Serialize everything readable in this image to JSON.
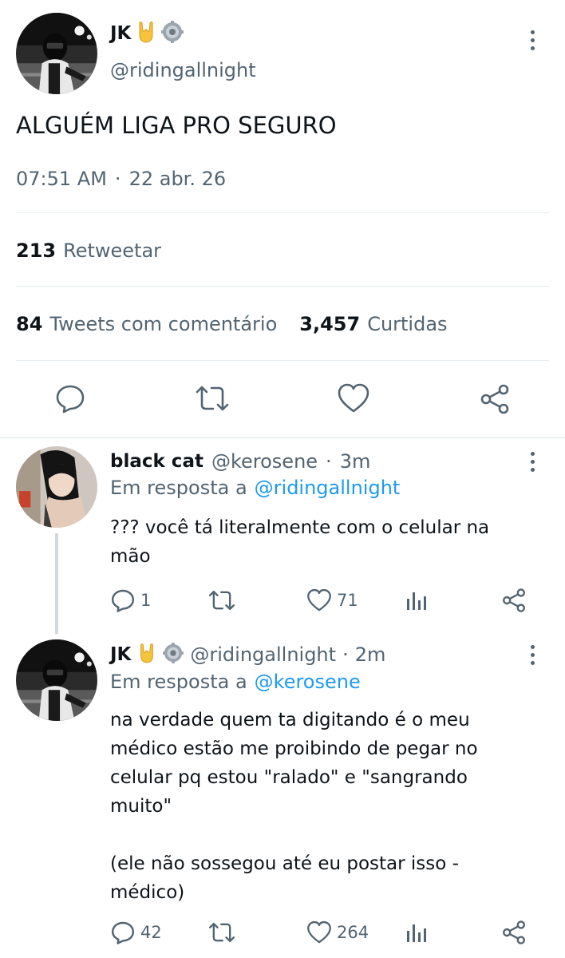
{
  "main_tweet": {
    "author_name": "JK",
    "handle": "@ridingallnight",
    "text": "ALGUÉM LIGA PRO SEGURO",
    "time": "07:51 AM",
    "separator": "·",
    "date": "22 abr. 26",
    "retweets_count": "213",
    "retweets_label": "Retweetar",
    "replies_count": "84",
    "replies_label": "Tweets com comentário",
    "likes_count": "3,457",
    "likes_label": "Curtidas"
  },
  "replies": [
    {
      "author_name": "black cat",
      "handle": "@kerosene",
      "separator": "·",
      "time_ago": "3m",
      "reply_prefix": "Em resposta a",
      "reply_to": "@ridingallnight",
      "text": "??? você tá literalmente com o celular na\nmão",
      "reply_count": "1",
      "retweet_count": "",
      "like_count": "71"
    },
    {
      "author_name": "JK",
      "handle": "@ridingallnight",
      "separator": "·",
      "time_ago": "2m",
      "reply_prefix": "Em resposta a",
      "reply_to": "@kerosene",
      "text": "na verdade quem ta digitando é o meu\nmédico estão me proibindo de pegar no\ncelular pq estou \"ralado\" e \"sangrando\nmuito\"\n\n(ele não sossegou até eu postar isso -\nmédico)",
      "reply_count": "42",
      "retweet_count": "",
      "like_count": "264"
    }
  ],
  "icons": {
    "badge_1": "rock-hand-emoji-icon",
    "badge_2": "gear-icon",
    "reply": "reply-bubble-icon",
    "retweet": "retweet-icon",
    "like": "heart-icon",
    "share": "share-icon",
    "analytics": "analytics-icon",
    "more": "more-vertical-icon"
  },
  "colors": {
    "text": "#0f1419",
    "secondary": "#536471",
    "link": "#1d9bf0",
    "divider": "#e6ecf0"
  }
}
